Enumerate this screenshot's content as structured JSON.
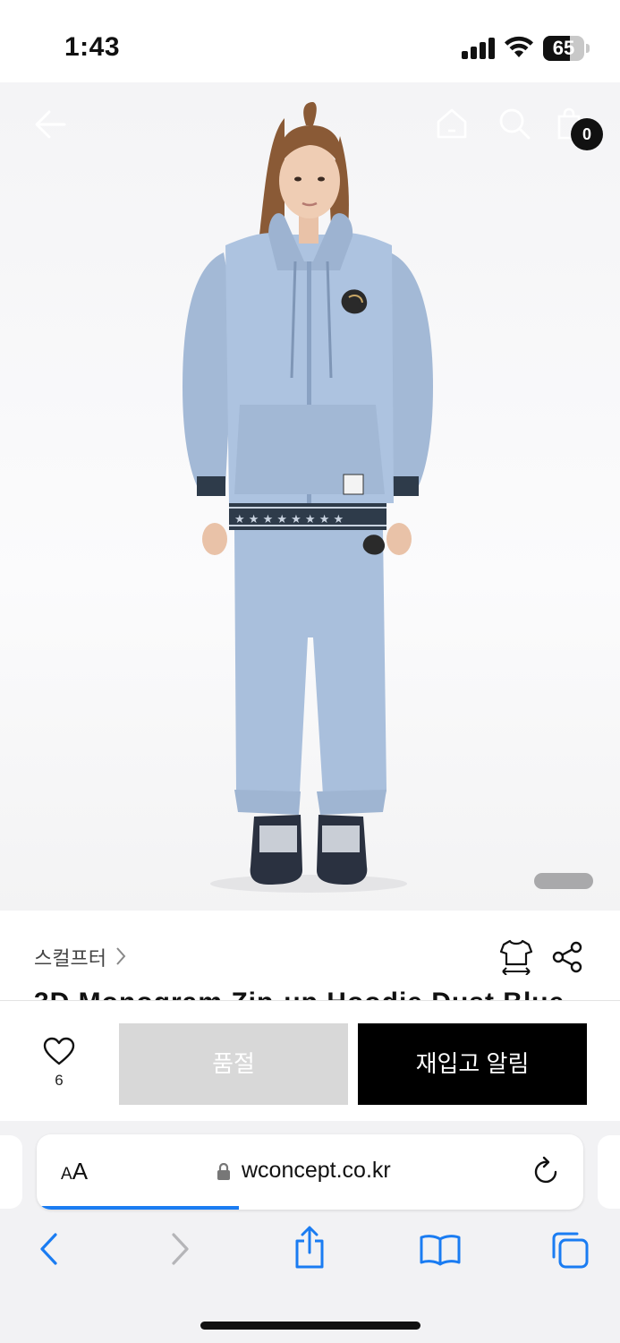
{
  "status_bar": {
    "time": "1:43",
    "battery": "65",
    "battery_level": 0.65
  },
  "header": {
    "icons": [
      "back-arrow-icon",
      "home-icon",
      "search-icon",
      "shopping-bag-icon"
    ],
    "cart_count": "0"
  },
  "product": {
    "brand": "스컬프터",
    "title": "3D Monogram Zip-up Hoodie Dust Blue",
    "image_alt": "model wearing light blue zip-up hoodie and jogger pants",
    "colors": {
      "garment": "#a9bfdc",
      "rib": "#2e3b4a"
    }
  },
  "purchase_bar": {
    "like_count": "6",
    "sold_out_label": "품절",
    "restock_label": "재입고 알림"
  },
  "browser": {
    "text_size_label_small": "A",
    "text_size_label_large": "A",
    "url": "wconcept.co.kr",
    "load_progress": 0.37,
    "accent": "#1a7cf2",
    "nav_icons": [
      "back-icon",
      "forward-icon",
      "share-icon",
      "bookmarks-icon",
      "tabs-icon"
    ]
  }
}
